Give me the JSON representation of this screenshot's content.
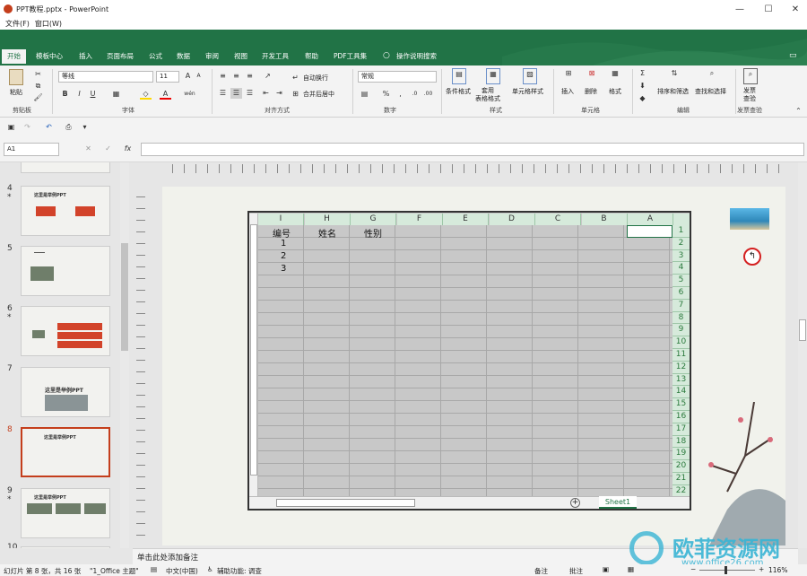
{
  "window": {
    "title": "PPT教程.pptx - PowerPoint"
  },
  "menu": [
    "文件(F)",
    "窗口(W)"
  ],
  "tabs": [
    "开始",
    "模板中心",
    "插入",
    "页面布局",
    "公式",
    "数据",
    "审阅",
    "视图",
    "开发工具",
    "帮助",
    "PDF工具集",
    "操作说明搜索"
  ],
  "ribbon": {
    "paste": "粘贴",
    "clipboard": "剪贴板",
    "font_name": "等线",
    "font_size": "11",
    "font_group": "字体",
    "wrap": "自动换行",
    "merge": "合并后居中",
    "align_group": "对齐方式",
    "number_format": "常规",
    "number_group": "数字",
    "cond_format": "条件格式",
    "table_format": "套用\n表格格式",
    "cell_style": "单元格样式",
    "style_group": "样式",
    "insert": "插入",
    "delete": "删除",
    "format": "格式",
    "cells_group": "单元格",
    "sort": "排序和筛选",
    "find": "查找和选择",
    "edit_group": "编辑",
    "invoice": "发票\n查验",
    "invoice_group": "发票查验"
  },
  "formula": {
    "namebox": "A1",
    "fx": "fx"
  },
  "thumbnails": [
    {
      "num": "4",
      "star": "*",
      "title": "这里是举例PPT"
    },
    {
      "num": "5",
      "star": "",
      "title": ""
    },
    {
      "num": "6",
      "star": "*",
      "title": ""
    },
    {
      "num": "7",
      "star": "",
      "title": "这里是举例PPT"
    },
    {
      "num": "8",
      "star": "",
      "title": "这里是举例PPT"
    },
    {
      "num": "9",
      "star": "*",
      "title": "这里是举例PPT"
    },
    {
      "num": "10",
      "star": "",
      "title": ""
    }
  ],
  "sheet": {
    "columns": [
      "I",
      "H",
      "G",
      "F",
      "E",
      "D",
      "C",
      "B",
      "A"
    ],
    "rows": [
      "1",
      "2",
      "3",
      "4",
      "5",
      "6",
      "7",
      "8",
      "9",
      "10",
      "11",
      "12",
      "13",
      "14",
      "15",
      "16",
      "17",
      "18",
      "19",
      "20",
      "21",
      "22"
    ],
    "headers": [
      "编号",
      "姓名",
      "性别"
    ],
    "ids": [
      "1",
      "2",
      "3"
    ],
    "tab": "Sheet1"
  },
  "notes_placeholder": "单击此处添加备注",
  "status": {
    "slide": "幻灯片 第 8 张，共 16 张",
    "theme": "\"1_Office 主题\"",
    "lang": "中文(中国)",
    "access": "辅助功能: 调查",
    "notes": "备注",
    "comments": "批注",
    "zoom": "116%"
  },
  "watermark": {
    "cn": "欧菲资源网",
    "url": "www.office26.com"
  }
}
